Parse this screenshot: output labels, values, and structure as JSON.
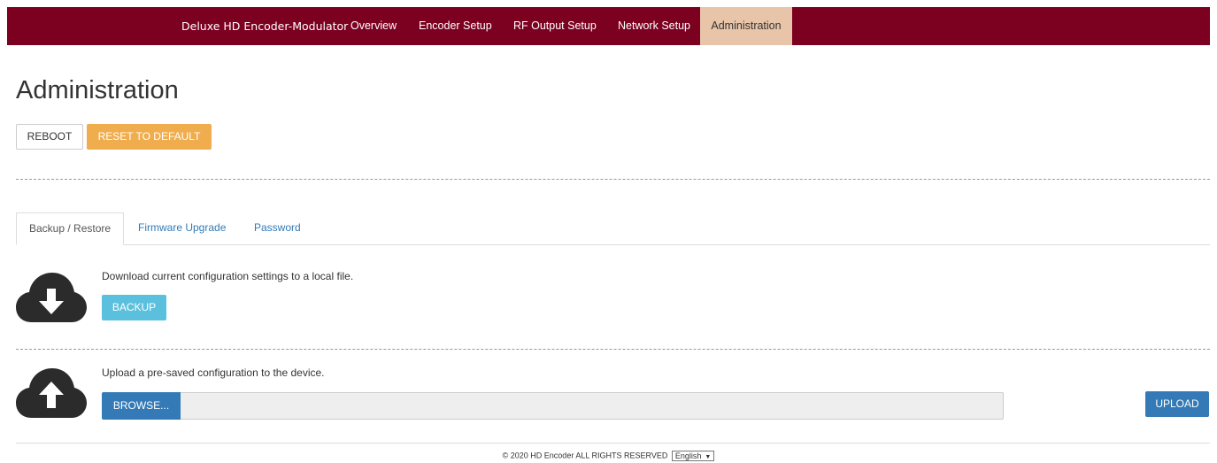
{
  "navbar": {
    "brand": "Deluxe HD Encoder-Modulator",
    "items": [
      {
        "label": "Overview"
      },
      {
        "label": "Encoder Setup"
      },
      {
        "label": "RF Output Setup"
      },
      {
        "label": "Network Setup"
      },
      {
        "label": "Administration",
        "active": true
      }
    ],
    "background_color": "#7c0020",
    "active_color": "#e8c4a8"
  },
  "page": {
    "title": "Administration"
  },
  "actions": {
    "reboot_label": "REBOOT",
    "reset_label": "RESET TO DEFAULT"
  },
  "tabs": [
    {
      "label": "Backup / Restore",
      "active": true
    },
    {
      "label": "Firmware Upgrade"
    },
    {
      "label": "Password"
    }
  ],
  "backup": {
    "icon": "cloud-download-icon",
    "description": "Download current configuration settings to a local file.",
    "button_label": "BACKUP"
  },
  "restore": {
    "icon": "cloud-upload-icon",
    "description": "Upload a pre-saved configuration to the device.",
    "browse_label": "BROWSE...",
    "file_value": "",
    "upload_label": "UPLOAD"
  },
  "footer": {
    "copyright": "© 2020 HD Encoder ALL RIGHTS RESERVED",
    "language_selected": "English"
  },
  "colors": {
    "warning": "#f0ad4e",
    "info": "#5bc0de",
    "primary": "#337ab7"
  }
}
